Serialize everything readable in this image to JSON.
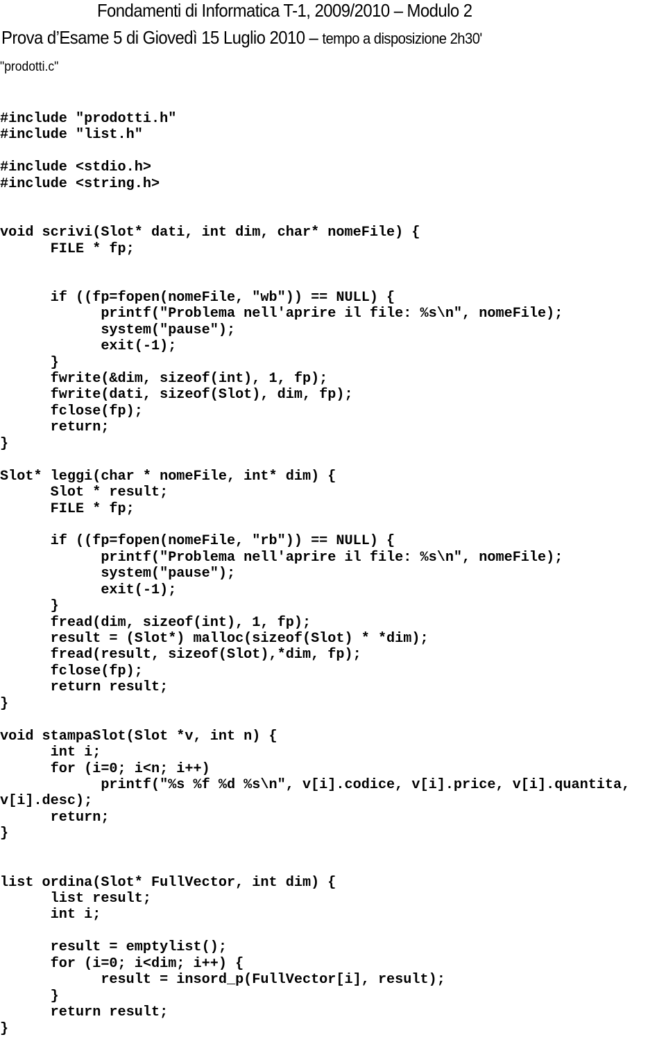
{
  "header": {
    "title": "Fondamenti di Informatica T-1, 2009/2010 – Modulo 2",
    "subtitle_main": "Prova d’Esame 5 di Giovedì 15 Luglio 2010 – ",
    "subtitle_tail": "tempo a disposizione 2h30'"
  },
  "filename": "\"prodotti.c\"",
  "code_lines": [
    "#include \"prodotti.h\"",
    "#include \"list.h\"",
    "",
    "#include <stdio.h>",
    "#include <string.h>",
    "",
    "",
    "void scrivi(Slot* dati, int dim, char* nomeFile) {",
    "      FILE * fp;",
    "",
    "",
    "      if ((fp=fopen(nomeFile, \"wb\")) == NULL) {",
    "            printf(\"Problema nell'aprire il file: %s\\n\", nomeFile);",
    "            system(\"pause\");",
    "            exit(-1);",
    "      }",
    "      fwrite(&dim, sizeof(int), 1, fp);",
    "      fwrite(dati, sizeof(Slot), dim, fp);",
    "      fclose(fp);",
    "      return;",
    "}",
    "",
    "Slot* leggi(char * nomeFile, int* dim) {",
    "      Slot * result;",
    "      FILE * fp;",
    "",
    "      if ((fp=fopen(nomeFile, \"rb\")) == NULL) {",
    "            printf(\"Problema nell'aprire il file: %s\\n\", nomeFile);",
    "            system(\"pause\");",
    "            exit(-1);",
    "      }",
    "      fread(dim, sizeof(int), 1, fp);",
    "      result = (Slot*) malloc(sizeof(Slot) * *dim);",
    "      fread(result, sizeof(Slot),*dim, fp);",
    "      fclose(fp);",
    "      return result;",
    "}",
    "",
    "void stampaSlot(Slot *v, int n) {",
    "      int i;",
    "      for (i=0; i<n; i++)",
    "            printf(\"%s %f %d %s\\n\", v[i].codice, v[i].price, v[i].quantita,",
    "v[i].desc);",
    "      return;",
    "}",
    "",
    "",
    "list ordina(Slot* FullVector, int dim) {",
    "      list result;",
    "      int i;",
    "",
    "      result = emptylist();",
    "      for (i=0; i<dim; i++) {",
    "            result = insord_p(FullVector[i], result);",
    "      }",
    "      return result;",
    "}"
  ]
}
